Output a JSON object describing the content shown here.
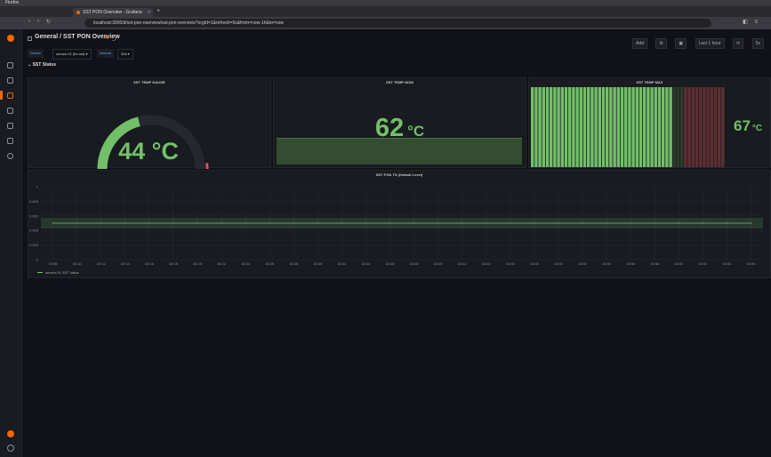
{
  "browser": {
    "app_label": "Firefox",
    "tab_title": "SST PON Overview - Grafana",
    "url": "localhost:3000/d/sst-pon-overview/sst-pon-overview?orgId=1&refresh=5s&from=now-1h&to=now",
    "new_tab": "+"
  },
  "header": {
    "breadcrumb": "General / SST PON Overview",
    "time_range": "Last 1 hour",
    "refresh": "5s",
    "tools": [
      "Add",
      "⚙",
      "▣",
      "⟳"
    ]
  },
  "variables": [
    {
      "label": "Device",
      "value": "sensor-01 (ttn-sst) ▾"
    },
    {
      "label": "Interval",
      "value": "30s ▾"
    }
  ],
  "row": {
    "title": "⌄ SST Status"
  },
  "panels": {
    "gauge": {
      "title": "SST TEMP GAUGE",
      "value": "44",
      "unit": "°C",
      "fraction": 0.44,
      "color": "#73bf69",
      "threshold_color": "#f2495c"
    },
    "stat": {
      "title": "SST TEMP NOW",
      "value": "62",
      "unit": "°C",
      "color": "#73bf69"
    },
    "bargauge": {
      "title": "SST TEMP MAX",
      "value": "67",
      "unit": "°C",
      "fraction": 0.67,
      "color": "#73bf69",
      "warn_color": "#5d2f32"
    },
    "timeseries": {
      "title": "SST PON TS (Default Level)",
      "legend": "sensor-01 SST Value",
      "color": "#73bf69"
    }
  },
  "chart_data": {
    "type": "line",
    "title": "SST PON TS (Default Level)",
    "x": [
      "15:08",
      "15:10",
      "15:12",
      "15:14",
      "15:16",
      "15:18",
      "15:20",
      "15:22",
      "15:24",
      "15:26",
      "15:28",
      "15:30",
      "15:32",
      "15:34",
      "15:36",
      "15:38",
      "15:40",
      "15:42",
      "15:44",
      "15:46",
      "15:48",
      "15:50",
      "15:52",
      "15:54",
      "15:56",
      "15:58",
      "16:00",
      "16:02",
      "16:04",
      "16:06"
    ],
    "series": [
      {
        "name": "sensor-01 SST Value",
        "values": [
          0.5,
          0.5,
          0.5,
          0.5,
          0.5,
          0.5,
          0.5,
          0.5,
          0.5,
          0.5,
          0.5,
          0.5,
          0.5,
          0.5,
          0.5,
          0.5,
          0.5,
          0.5,
          0.5,
          0.5,
          0.5,
          0.5,
          0.5,
          0.5,
          0.5,
          0.5,
          0.5,
          0.5,
          0.5,
          0.5
        ]
      }
    ],
    "yticks": [
      "1",
      "0.800",
      "0.600",
      "0.400",
      "0.200",
      "0"
    ],
    "ylim": [
      0,
      1
    ],
    "grid": true,
    "legend_position": "bottom-left"
  }
}
